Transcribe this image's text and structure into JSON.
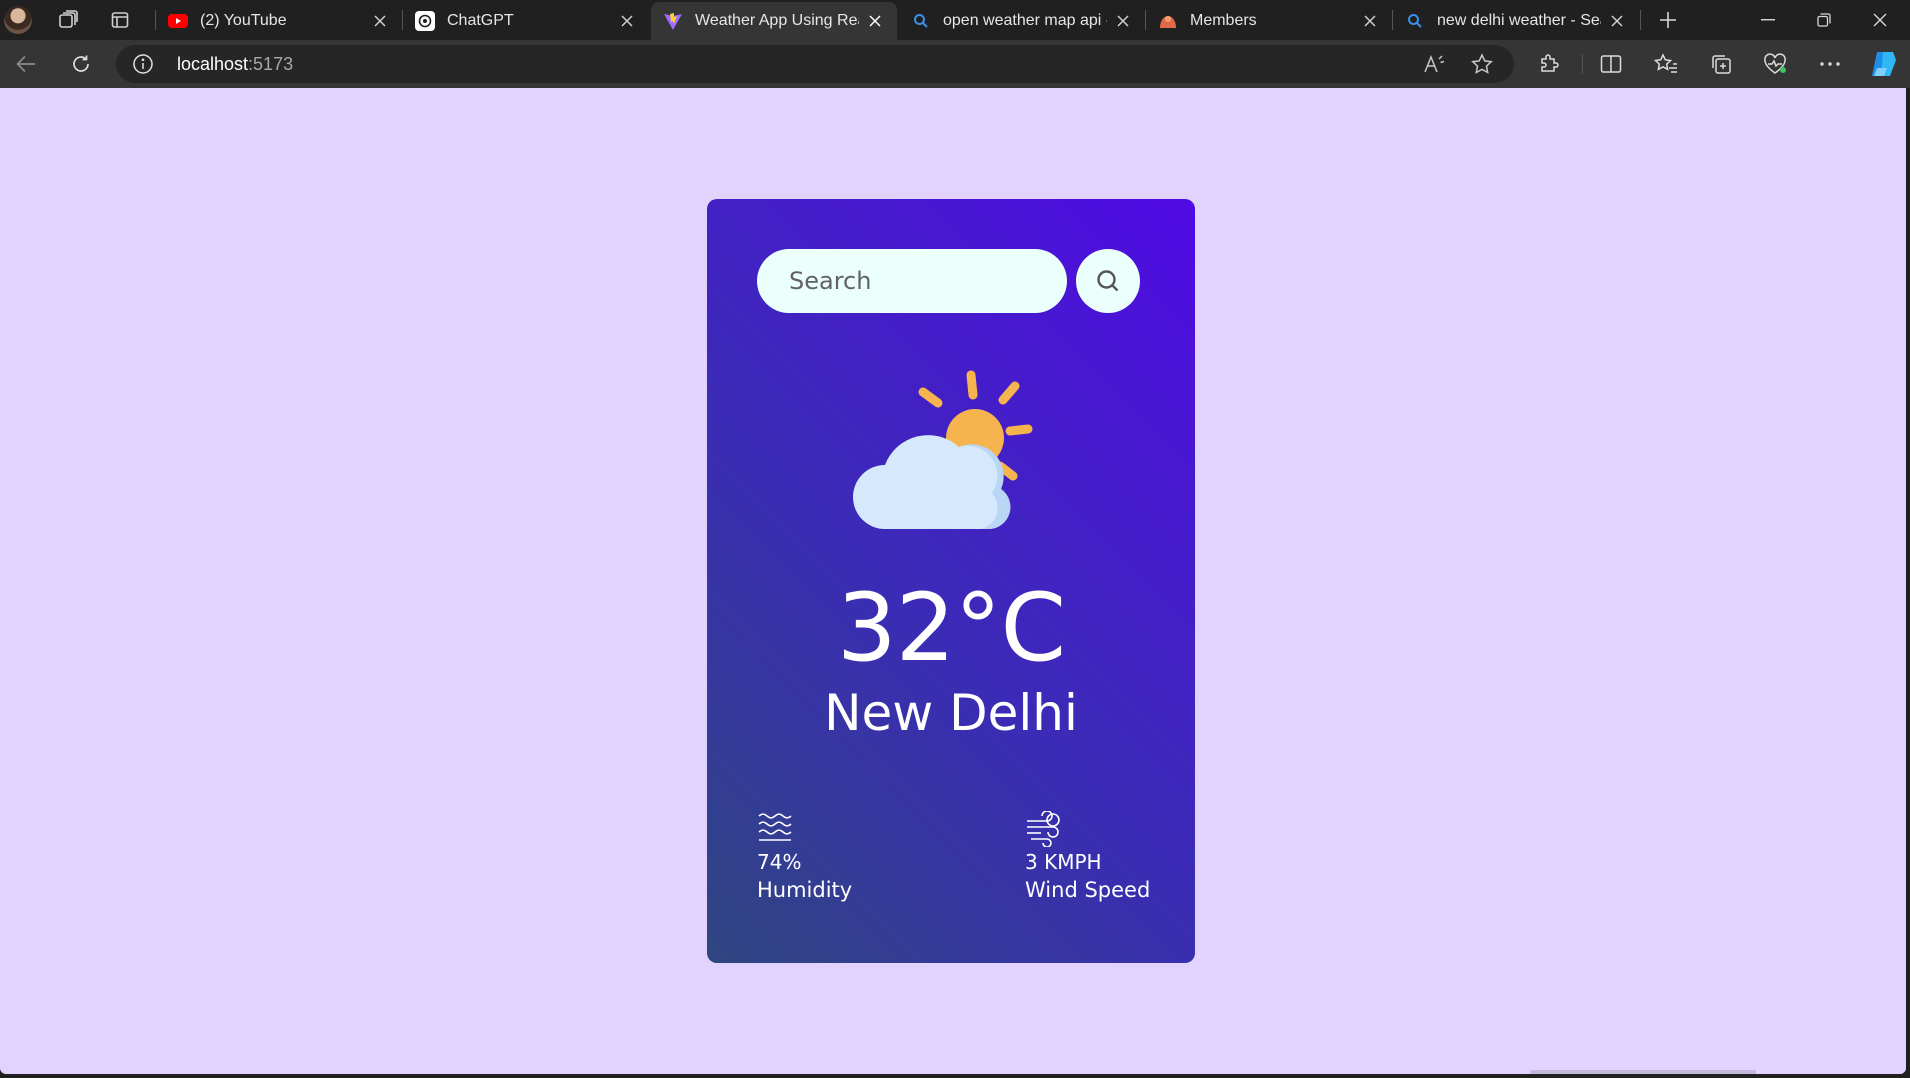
{
  "browser": {
    "tabs": [
      {
        "title": "(2) YouTube",
        "favicon": "youtube-icon",
        "active": false
      },
      {
        "title": "ChatGPT",
        "favicon": "chatgpt-icon",
        "active": false
      },
      {
        "title": "Weather App Using React",
        "favicon": "vite-icon",
        "active": true
      },
      {
        "title": "open weather map api - Search",
        "favicon": "search-icon",
        "active": false
      },
      {
        "title": "Members",
        "favicon": "members-icon",
        "active": false
      },
      {
        "title": "new delhi weather - Search",
        "favicon": "search-icon",
        "active": false
      }
    ],
    "address": {
      "host": "localhost",
      "port": ":5173"
    }
  },
  "app": {
    "search": {
      "placeholder": "Search",
      "value": ""
    },
    "weather": {
      "icon": "partly-cloudy-icon",
      "temperature": "32°C",
      "location": "New Delhi",
      "humidity": {
        "value": "74%",
        "label": "Humidity",
        "icon": "humidity-icon"
      },
      "wind": {
        "value": "3 KMPH",
        "label": "Wind Speed",
        "icon": "wind-icon"
      }
    }
  },
  "colors": {
    "page_background": "#e2d3fe",
    "card_gradient_start": "#2f4680",
    "card_gradient_end": "#500ae4",
    "search_background": "#ebfffc",
    "sun": "#f6b44e",
    "cloud": "#d6e8fb"
  }
}
